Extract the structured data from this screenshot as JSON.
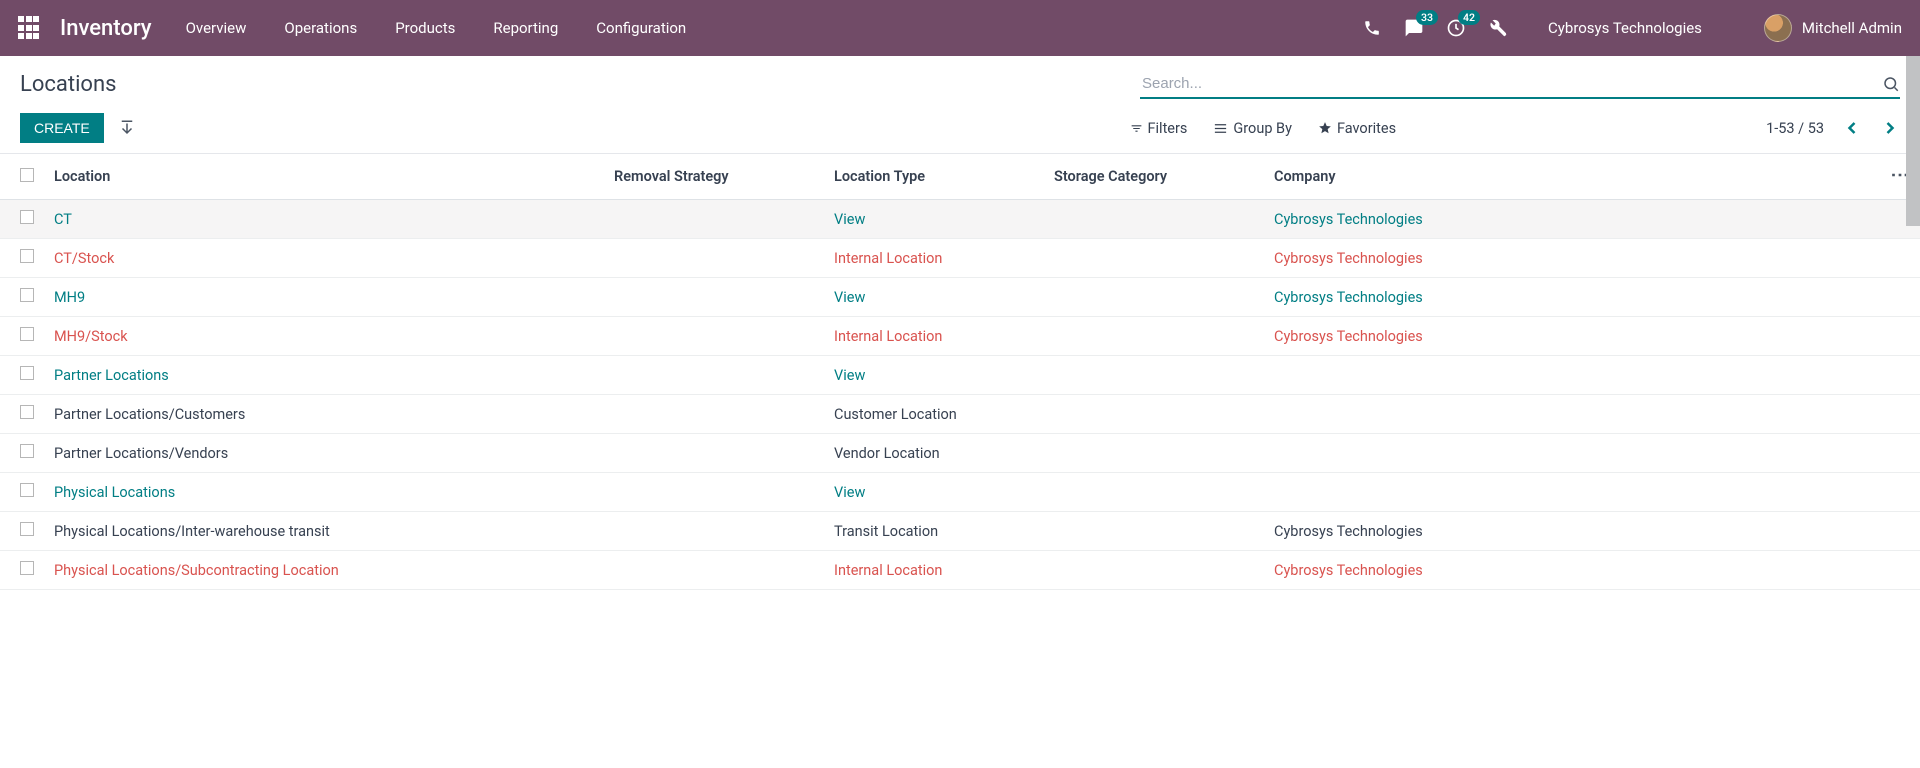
{
  "colors": {
    "brand": "#714b67",
    "accent": "#017e84",
    "danger": "#d9534f"
  },
  "navbar": {
    "app_title": "Inventory",
    "menu": [
      "Overview",
      "Operations",
      "Products",
      "Reporting",
      "Configuration"
    ],
    "badges": {
      "messages": "33",
      "activities": "42"
    },
    "company": "Cybrosys Technologies",
    "user": "Mitchell Admin"
  },
  "cp": {
    "title": "Locations",
    "create": "CREATE",
    "search_placeholder": "Search...",
    "filters_label": "Filters",
    "groupby_label": "Group By",
    "favorites_label": "Favorites",
    "pager": "1-53 / 53"
  },
  "table": {
    "columns": [
      "Location",
      "Removal Strategy",
      "Location Type",
      "Storage Category",
      "Company"
    ],
    "rows": [
      {
        "loc": "CT",
        "type": "View",
        "company": "Cybrosys Technologies",
        "removal": "",
        "category": "",
        "style": "blue",
        "highlight": true
      },
      {
        "loc": "CT/Stock",
        "type": "Internal Location",
        "company": "Cybrosys Technologies",
        "removal": "",
        "category": "",
        "style": "red"
      },
      {
        "loc": "MH9",
        "type": "View",
        "company": "Cybrosys Technologies",
        "removal": "",
        "category": "",
        "style": "blue"
      },
      {
        "loc": "MH9/Stock",
        "type": "Internal Location",
        "company": "Cybrosys Technologies",
        "removal": "",
        "category": "",
        "style": "red"
      },
      {
        "loc": "Partner Locations",
        "type": "View",
        "company": "",
        "removal": "",
        "category": "",
        "style": "blue"
      },
      {
        "loc": "Partner Locations/Customers",
        "type": "Customer Location",
        "company": "",
        "removal": "",
        "category": "",
        "style": "plain"
      },
      {
        "loc": "Partner Locations/Vendors",
        "type": "Vendor Location",
        "company": "",
        "removal": "",
        "category": "",
        "style": "plain"
      },
      {
        "loc": "Physical Locations",
        "type": "View",
        "company": "",
        "removal": "",
        "category": "",
        "style": "blue"
      },
      {
        "loc": "Physical Locations/Inter-warehouse transit",
        "type": "Transit Location",
        "company": "Cybrosys Technologies",
        "removal": "",
        "category": "",
        "style": "plain"
      },
      {
        "loc": "Physical Locations/Subcontracting Location",
        "type": "Internal Location",
        "company": "Cybrosys Technologies",
        "removal": "",
        "category": "",
        "style": "red"
      }
    ]
  }
}
